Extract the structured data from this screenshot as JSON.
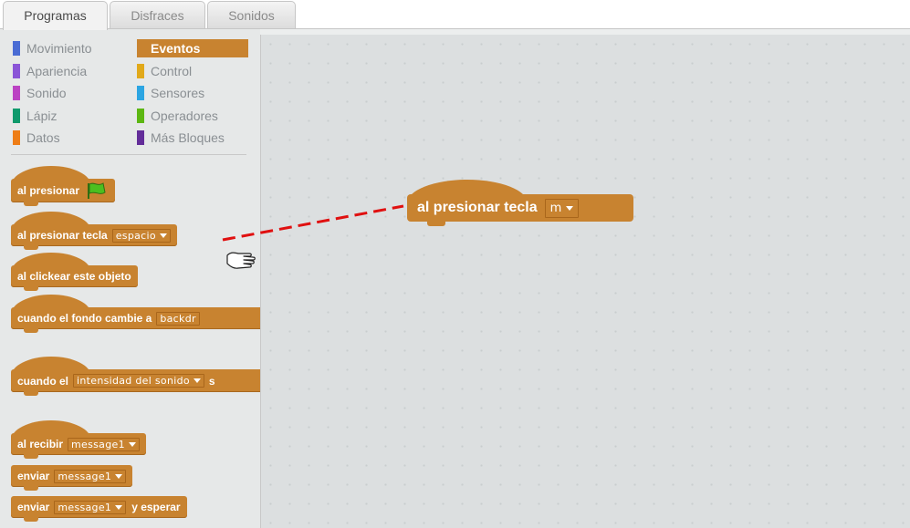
{
  "tabs": [
    {
      "label": "Programas",
      "active": true
    },
    {
      "label": "Disfraces",
      "active": false
    },
    {
      "label": "Sonidos",
      "active": false
    }
  ],
  "categories": [
    {
      "label": "Movimiento",
      "color": "#4a6cd4"
    },
    {
      "label": "Apariencia",
      "color": "#8a55d7"
    },
    {
      "label": "Sonido",
      "color": "#bb42c3"
    },
    {
      "label": "Lápiz",
      "color": "#0e9a6c"
    },
    {
      "label": "Datos",
      "color": "#ee7d16"
    },
    {
      "label": "Eventos",
      "color": "#c88330",
      "selected": true
    },
    {
      "label": "Control",
      "color": "#e1a91a"
    },
    {
      "label": "Sensores",
      "color": "#2ca5e2"
    },
    {
      "label": "Operadores",
      "color": "#5cb712"
    },
    {
      "label": "Más Bloques",
      "color": "#632d99"
    }
  ],
  "blocks": {
    "green_flag": {
      "label": "al presionar",
      "icon": "green-flag-icon"
    },
    "key_press": {
      "label": "al presionar tecla",
      "key": "espacio"
    },
    "sprite_click": {
      "label": "al clickear este objeto"
    },
    "backdrop": {
      "label": "cuando el fondo cambie a",
      "value": "backdr"
    },
    "sensor": {
      "label": "cuando el",
      "value": "intensidad del sonido",
      "tail": "s"
    },
    "receive": {
      "label": "al recibir",
      "value": "message1"
    },
    "broadcast": {
      "label": "enviar",
      "value": "message1"
    },
    "broadcast_wait": {
      "label": "enviar",
      "value": "message1",
      "tail": "y esperar"
    }
  },
  "script_area": {
    "block": {
      "label": "al presionar tecla",
      "key": "m"
    }
  },
  "colors": {
    "events": "#c88330",
    "drag_line": "#e01010"
  }
}
